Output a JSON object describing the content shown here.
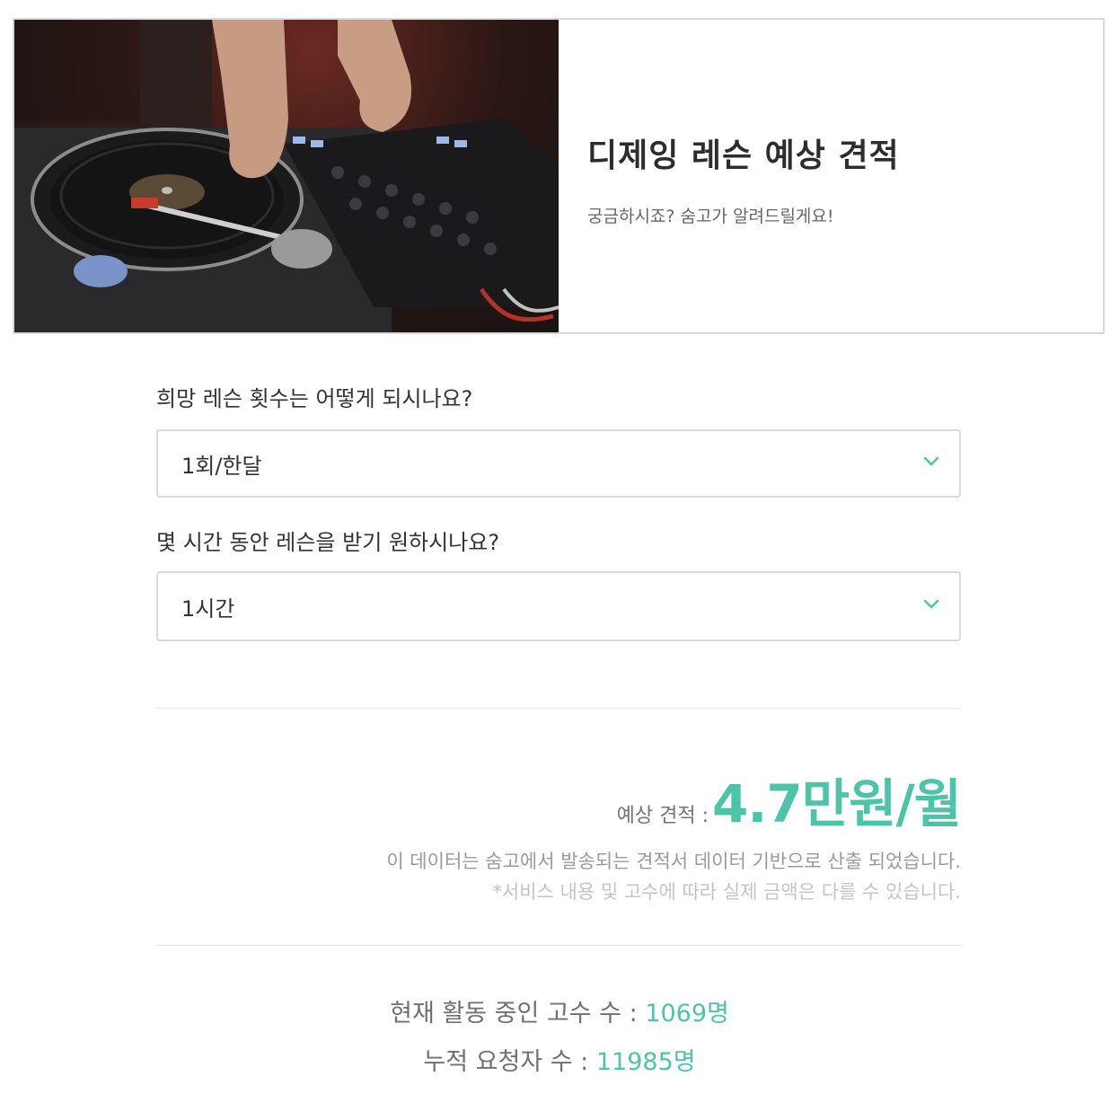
{
  "hero": {
    "title": "디제잉 레슨 예상 견적",
    "subtitle": "궁금하시죠? 숨고가 알려드릴게요!"
  },
  "questions": [
    {
      "label": "희망 레슨 횟수는 어떻게 되시나요?",
      "selected": "1회/한달"
    },
    {
      "label": "몇 시간 동안 레슨을 받기 원하시나요?",
      "selected": "1시간"
    }
  ],
  "estimate": {
    "label": "예상 견적 :",
    "value": "4.7만원/월",
    "note_primary": "이 데이터는 숨고에서 발송되는 견적서 데이터 기반으로 산출 되었습니다.",
    "note_secondary": "*서비스 내용 및 고수에 따라 실제 금액은 다를 수 있습니다."
  },
  "stats": {
    "active_pros_label": "현재 활동 중인 고수 수 :",
    "active_pros_value": "1069명",
    "requesters_label": "누적 요청자 수 :",
    "requesters_value": "11985명"
  },
  "colors": {
    "accent": "#4cc4a8",
    "border": "#dadada"
  },
  "icons": {
    "dropdown": "chevron-down-icon"
  }
}
